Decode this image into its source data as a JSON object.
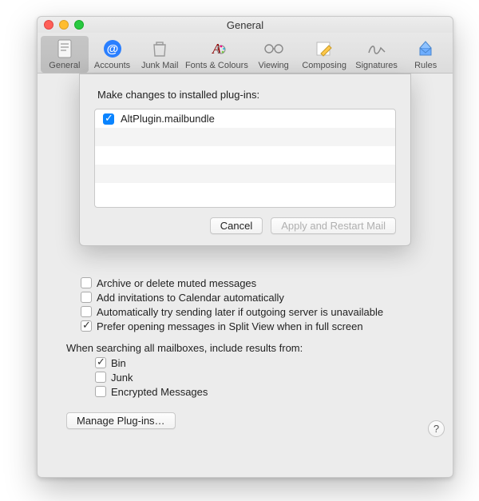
{
  "window": {
    "title": "General"
  },
  "toolbar": {
    "items": [
      {
        "label": "General"
      },
      {
        "label": "Accounts"
      },
      {
        "label": "Junk Mail"
      },
      {
        "label": "Fonts & Colours"
      },
      {
        "label": "Viewing"
      },
      {
        "label": "Composing"
      },
      {
        "label": "Signatures"
      },
      {
        "label": "Rules"
      }
    ]
  },
  "options": {
    "archive": "Archive or delete muted messages",
    "invitations": "Add invitations to Calendar automatically",
    "retry": "Automatically try sending later if outgoing server is unavailable",
    "splitview": "Prefer opening messages in Split View when in full screen"
  },
  "search": {
    "label": "When searching all mailboxes, include results from:",
    "bin": "Bin",
    "junk": "Junk",
    "encrypted": "Encrypted Messages"
  },
  "buttons": {
    "manage": "Manage Plug-ins…",
    "cancel": "Cancel",
    "apply": "Apply and Restart Mail"
  },
  "sheet": {
    "title": "Make changes to installed plug-ins:",
    "plugin": "AltPlugin.mailbundle"
  },
  "help": "?"
}
